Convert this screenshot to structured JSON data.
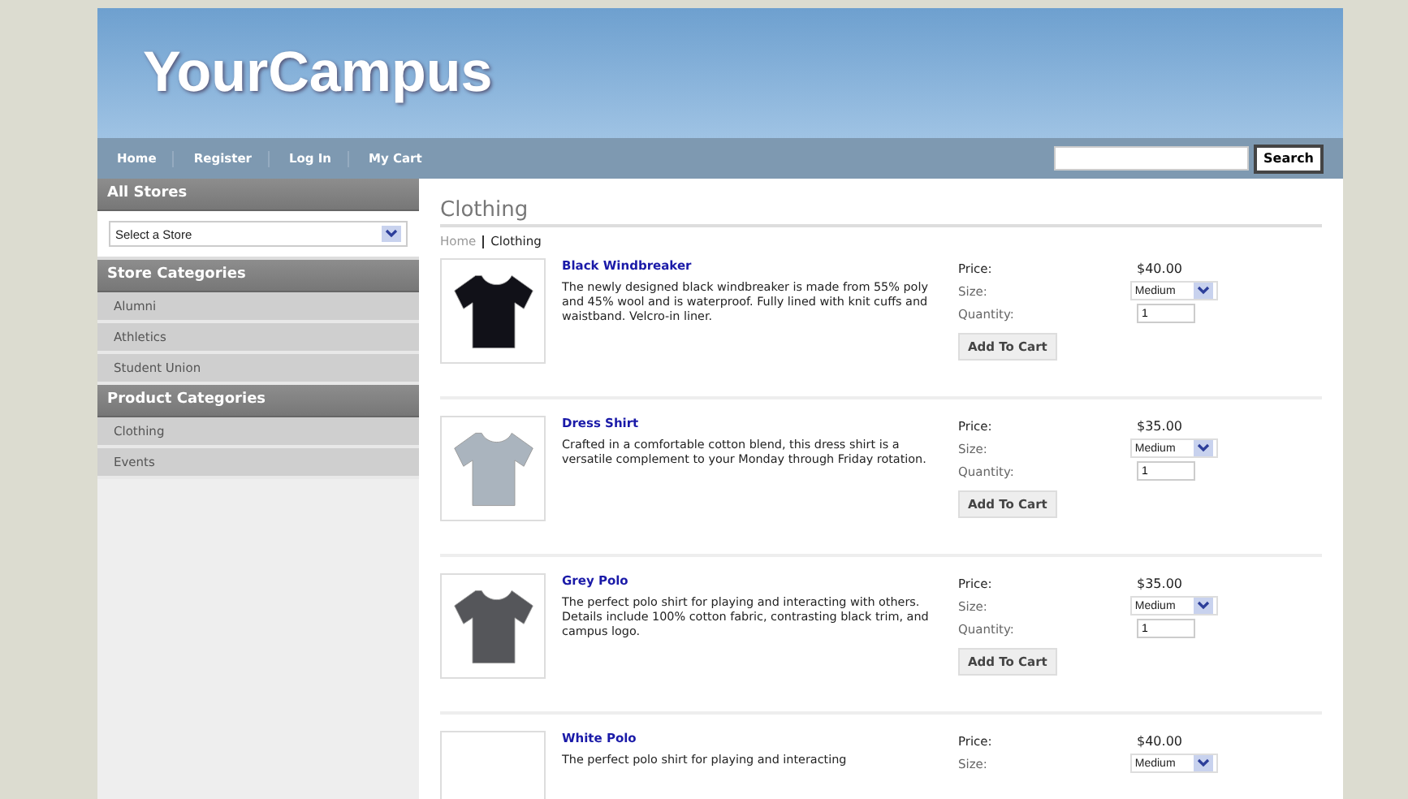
{
  "site": {
    "logo": "YourCampus"
  },
  "nav": {
    "links": [
      "Home",
      "Register",
      "Log In",
      "My Cart"
    ],
    "search_button": "Search"
  },
  "sidebar": {
    "sections": [
      {
        "title": "All Stores",
        "kind": "select",
        "select": "Select a Store"
      },
      {
        "title": "Store Categories",
        "kind": "list",
        "items": [
          "Alumni",
          "Athletics",
          "Student Union"
        ]
      },
      {
        "title": "Product Categories",
        "kind": "list",
        "items": [
          "Clothing",
          "Events"
        ]
      }
    ]
  },
  "main": {
    "heading": "Clothing",
    "breadcrumb": [
      "Home",
      "Clothing"
    ],
    "products": [
      {
        "name": "Black Windbreaker",
        "description": "The newly designed black windbreaker is made from 55% poly and 45% wool and is waterproof. Fully lined with knit cuffs and waistband. Velcro-in liner.",
        "price_label": "Price:",
        "price": "$40.00",
        "size_label": "Size:",
        "size": "Medium",
        "quantity_label": "Quantity:",
        "quantity": "1",
        "button": "Add To Cart",
        "color": "#111118"
      },
      {
        "name": "Dress Shirt",
        "description": "Crafted in a comfortable cotton blend, this dress shirt is a versatile complement to your Monday through Friday rotation.",
        "price_label": "Price:",
        "price": "$35.00",
        "size_label": "Size:",
        "size": "Medium",
        "quantity_label": "Quantity:",
        "quantity": "1",
        "button": "Add To Cart",
        "color": "#aab4be"
      },
      {
        "name": "Grey Polo",
        "description": "The perfect polo shirt for playing and interacting with others. Details include 100% cotton fabric, contrasting black trim, and campus logo.",
        "price_label": "Price:",
        "price": "$35.00",
        "size_label": "Size:",
        "size": "Medium",
        "quantity_label": "Quantity:",
        "quantity": "1",
        "button": "Add To Cart",
        "color": "#55565a"
      },
      {
        "name": "White Polo",
        "description": "The perfect polo shirt for playing and interacting",
        "price_label": "Price:",
        "price": "$40.00",
        "size_label": "Size:",
        "size": "Medium"
      }
    ]
  }
}
